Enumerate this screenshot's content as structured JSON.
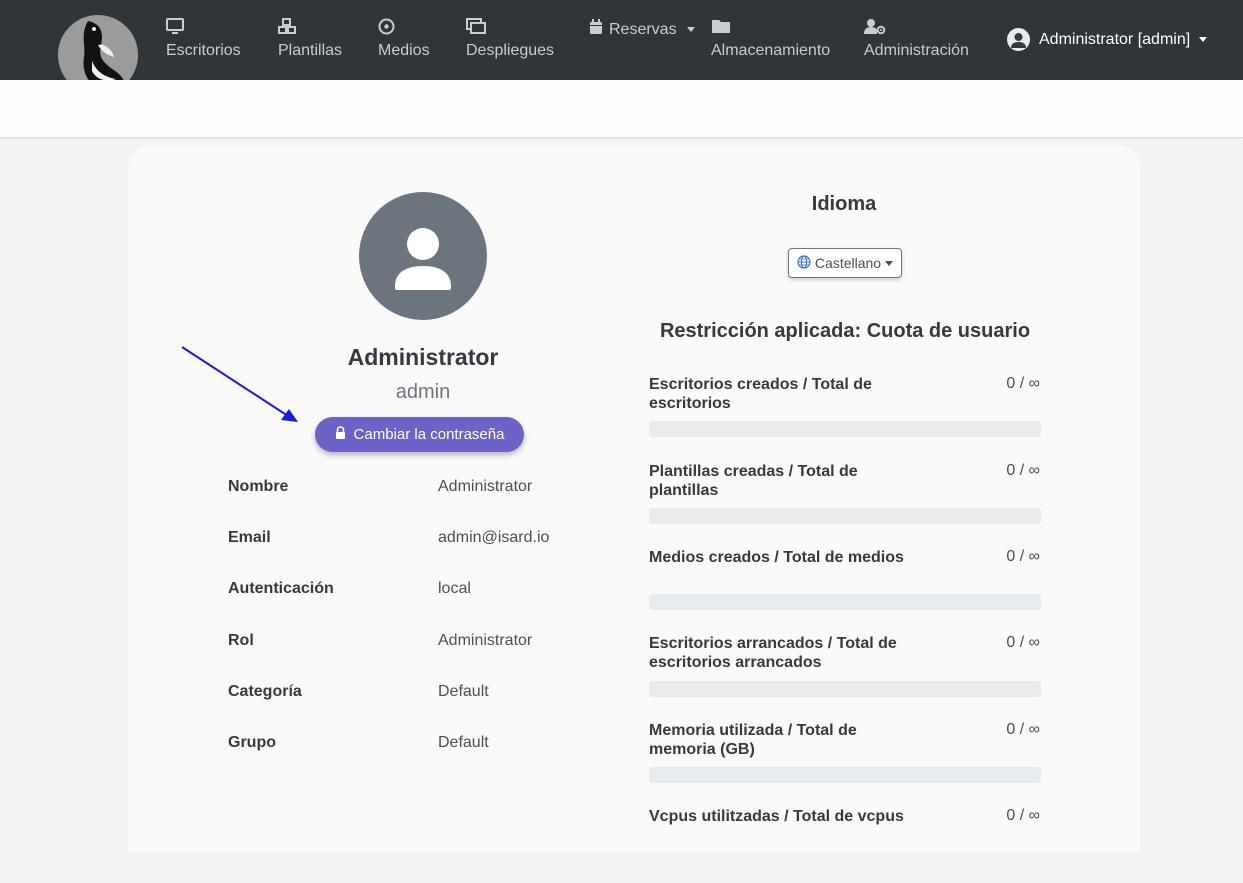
{
  "nav": {
    "items": [
      {
        "label": "Escritorios",
        "icon": "monitor-icon"
      },
      {
        "label": "Plantillas",
        "icon": "cubes-icon"
      },
      {
        "label": "Medios",
        "icon": "disc-icon"
      },
      {
        "label": "Despliegues",
        "icon": "deployments-icon"
      },
      {
        "label": "Reservas",
        "icon": "calendar-icon"
      },
      {
        "label": "Almacenamiento",
        "icon": "folder-icon"
      },
      {
        "label": "Administración",
        "icon": "user-gear-icon"
      }
    ],
    "user_label": "Administrator [admin]"
  },
  "profile": {
    "name": "Administrator",
    "username": "admin",
    "change_password_label": "Cambiar la contraseña",
    "fields": [
      {
        "label": "Nombre",
        "value": "Administrator"
      },
      {
        "label": "Email",
        "value": "admin@isard.io"
      },
      {
        "label": "Autenticación",
        "value": "local"
      },
      {
        "label": "Rol",
        "value": "Administrator"
      },
      {
        "label": "Categoría",
        "value": "Default"
      },
      {
        "label": "Grupo",
        "value": "Default"
      }
    ]
  },
  "language": {
    "title": "Idioma",
    "selected": "Castellano"
  },
  "quota": {
    "title": "Restricción aplicada: Cuota de usuario",
    "items": [
      {
        "label": "Escritorios creados / Total de escritorios",
        "value": "0 / ∞",
        "fraction": 0
      },
      {
        "label": "Plantillas creadas / Total de plantillas",
        "value": "0 / ∞",
        "fraction": 0
      },
      {
        "label": "Medios creados / Total de medios",
        "value": "0 / ∞",
        "fraction": 0
      },
      {
        "label": "Escritorios arrancados / Total de escritorios arrancados",
        "value": "0 / ∞",
        "fraction": 0
      },
      {
        "label": "Memoria utilizada / Total de memoria (GB)",
        "value": "0 / ∞",
        "fraction": 0
      },
      {
        "label": "Vcpus utilitzadas / Total de vcpus",
        "value": "0 / ∞",
        "fraction": 0
      }
    ]
  },
  "colors": {
    "navbar": "#30353a",
    "accent": "#6d62c8",
    "annotation_arrow": "#1a1adf"
  }
}
